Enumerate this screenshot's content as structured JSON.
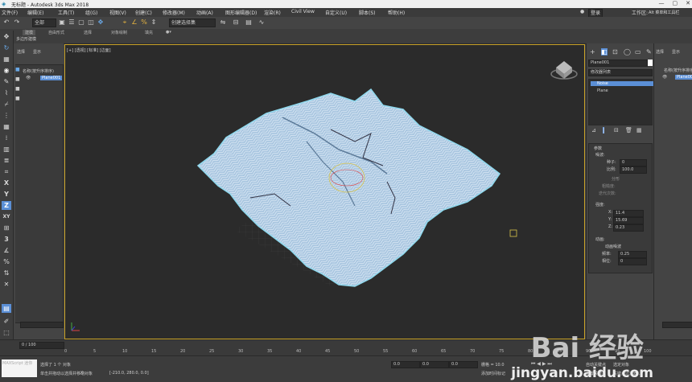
{
  "window": {
    "title": "无标题 - Autodesk 3ds Max 2018",
    "controls": [
      "—",
      "▢",
      "✕"
    ]
  },
  "menu": [
    "文件(F)",
    "编辑(E)",
    "工具(T)",
    "组(G)",
    "视图(V)",
    "创建(C)",
    "修改器(M)",
    "动画(A)",
    "图形编辑器(D)",
    "渲染(R)",
    "Civil View",
    "自定义(U)",
    "脚本(S)",
    "帮助(H)"
  ],
  "menu_right": {
    "login": "登录",
    "workspace_label": "工作区:",
    "workspace_value": "Alt 菜单和工具栏"
  },
  "toolbar": {
    "filter": "全部",
    "selection_set": "创建选择集"
  },
  "ribbon": {
    "tabs": [
      "建模",
      "自由形式",
      "选择",
      "对象绘制",
      "填充"
    ],
    "active": "建模",
    "sub": "多边形建模"
  },
  "scene_left": {
    "tabs": [
      "选择",
      "显示"
    ],
    "header": "名称(按升序排序)",
    "item": "Plane001"
  },
  "viewport": {
    "label": "[+] [透视] [标准] [边面]"
  },
  "command": {
    "object_name": "Plane001",
    "modifier_list": "修改器列表",
    "stack": [
      "Noise",
      "Plane"
    ],
    "params_title": "参数",
    "noise_label": "噪波:",
    "seed_label": "种子:",
    "seed": "0",
    "scale_label": "比例:",
    "scale": "100.0",
    "fractal_label": "分形",
    "roughness_label": "粗糙度:",
    "iterations_label": "迭代次数:",
    "strength_label": "强度:",
    "x_label": "X:",
    "x": "11.4",
    "y_label": "Y:",
    "y": "15.69",
    "z_label": "Z:",
    "z": "0.23",
    "animation_label": "动画:",
    "animate_noise_label": "动画噪波",
    "frequency_label": "频率:",
    "frequency": "0.25",
    "phase_label": "相位:",
    "phase": "0"
  },
  "timeline": {
    "frame": "0 / 100",
    "ticks": [
      "0",
      "5",
      "10",
      "15",
      "20",
      "25",
      "30",
      "35",
      "40",
      "45",
      "50",
      "55",
      "60",
      "65",
      "70",
      "75",
      "80",
      "85",
      "90",
      "95",
      "100"
    ]
  },
  "status": {
    "script": "MAXScript 迷你",
    "selected": "选择了 1 个 对象",
    "hint": "单击并拖动以选择并移动对象",
    "coord_label": "X:",
    "coord_value": "[-210.0, 280.0, 0.0]",
    "x": "0.0",
    "y": "0.0",
    "z": "0.0",
    "grid": "栅格 = 10.0",
    "add_time_tag": "添加时间标记",
    "auto_key": "自动关键点",
    "selected_obj": "选定对象",
    "set_key": "设置关键点",
    "key_filter": "关键点过滤器..."
  },
  "watermark": {
    "brand": "Bai 经验",
    "url": "jingyan.baidu.com"
  },
  "colors": {
    "viewport_border": "#c9a227",
    "mesh_fill": "#a9c6e0",
    "mesh_edge": "#8fd9ee",
    "highlight": "#5b8fd6"
  }
}
